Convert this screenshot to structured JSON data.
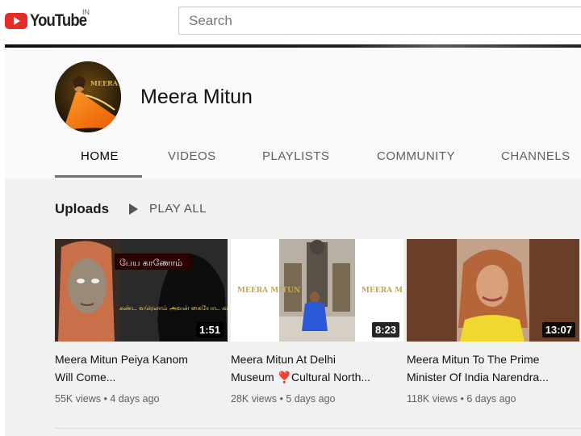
{
  "header": {
    "logo_text": "YouTube",
    "country_code": "IN",
    "search_placeholder": "Search"
  },
  "channel": {
    "name": "Meera Mitun",
    "avatar_watermark": "MEERA MITUN"
  },
  "tabs": [
    {
      "label": "HOME",
      "active": true
    },
    {
      "label": "VIDEOS",
      "active": false
    },
    {
      "label": "PLAYLISTS",
      "active": false
    },
    {
      "label": "COMMUNITY",
      "active": false
    },
    {
      "label": "CHANNELS",
      "active": false
    }
  ],
  "uploads": {
    "title": "Uploads",
    "play_all_label": "PLAY ALL"
  },
  "videos": [
    {
      "title_line1": "Meera Mitun Peiya Kanom",
      "title_line2": "Will Come...",
      "duration": "1:51",
      "views": "55K views",
      "age": "4 days ago",
      "thumb_caption_1": "பேய காணோம்",
      "thumb_caption_2": "கண்ட வரெலாம் அவன் கையோட கட்ட வாருங்"
    },
    {
      "title_line1": "Meera Mitun At Delhi",
      "title_line2": "Museum ❣️Cultural North...",
      "duration": "8:23",
      "views": "28K views",
      "age": "5 days ago",
      "thumb_logo": "MEERA MITUN"
    },
    {
      "title_line1": "Meera Mitun To The Prime",
      "title_line2": "Minister Of India Narendra...",
      "duration": "13:07",
      "views": "118K views",
      "age": "6 days ago"
    }
  ],
  "colors": {
    "brand_red": "#e52d27",
    "header_bg": "#f9f9f9",
    "content_bg": "#f1f1f1",
    "secondary_text": "#606060"
  }
}
